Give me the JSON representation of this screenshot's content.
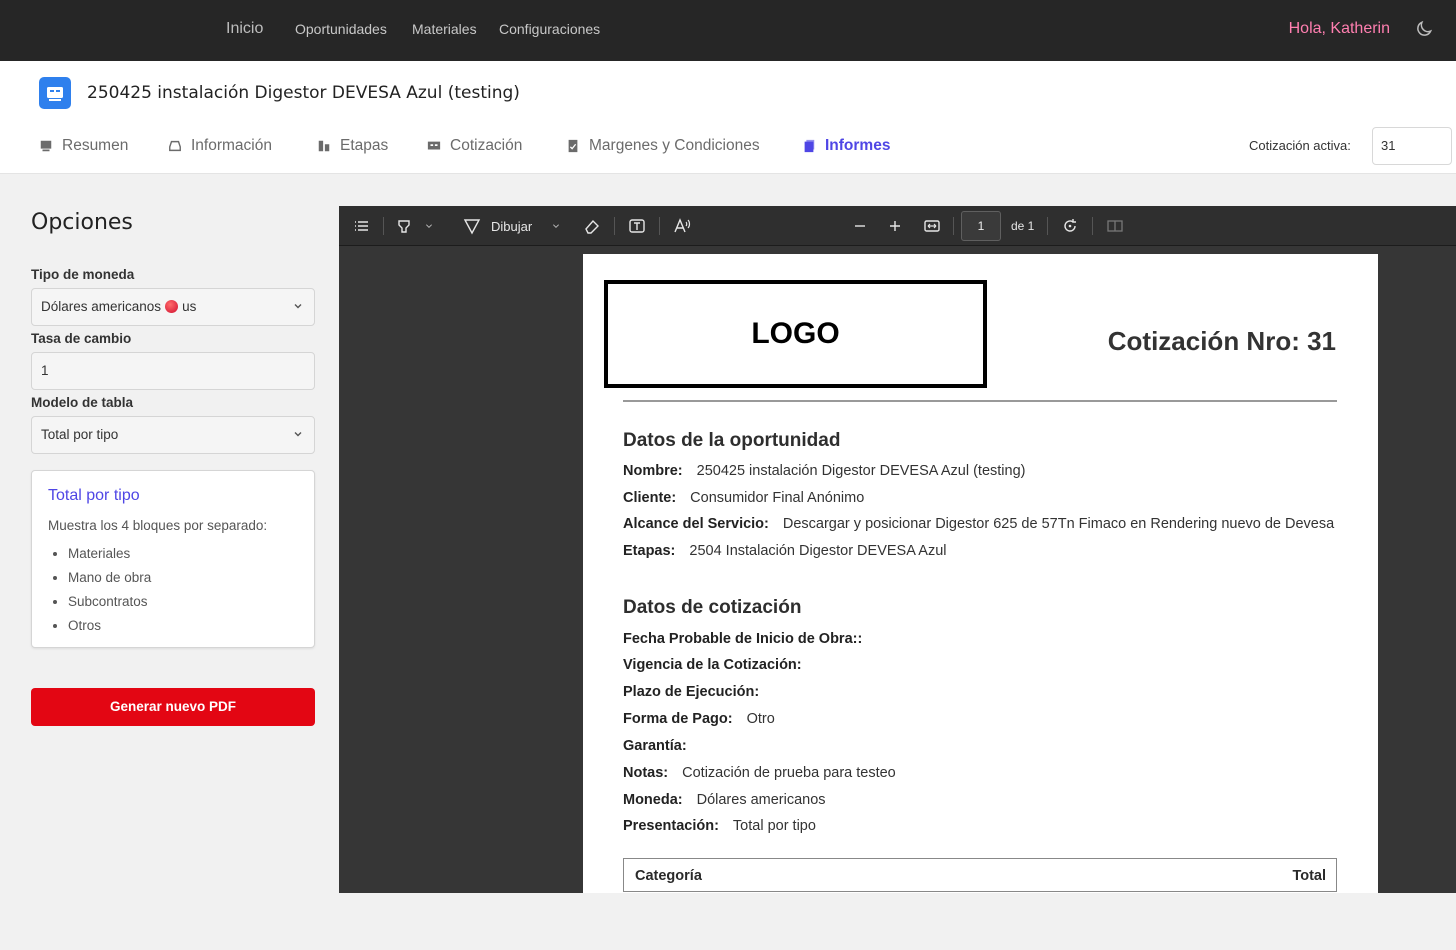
{
  "nav": {
    "home": "Inicio",
    "items": [
      "Oportunidades",
      "Materiales",
      "Configuraciones"
    ],
    "greeting": "Hola, Katherin"
  },
  "header": {
    "title": "250425 instalación Digestor DEVESA Azul (testing)",
    "tabs": [
      "Resumen",
      "Información",
      "Etapas",
      "Cotización",
      "Margenes y Condiciones",
      "Informes"
    ],
    "active_tab": "Informes",
    "active_quote_label": "Cotización activa:",
    "active_quote_value": "31"
  },
  "options": {
    "title": "Opciones",
    "currency_label": "Tipo de moneda",
    "currency_value": "Dólares americanos",
    "currency_code": "us",
    "rate_label": "Tasa de cambio",
    "rate_value": "1",
    "model_label": "Modelo de tabla",
    "model_value": "Total por tipo",
    "card": {
      "title": "Total por tipo",
      "desc": "Muestra los 4 bloques por separado:",
      "items": [
        "Materiales",
        "Mano de obra",
        "Subcontratos",
        "Otros"
      ]
    },
    "generate_button": "Generar nuevo PDF"
  },
  "viewer": {
    "draw_label": "Dibujar",
    "page_current": "1",
    "page_of": "de 1"
  },
  "pdf": {
    "logo": "LOGO",
    "quote_title": "Cotización Nro: 31",
    "section1": "Datos de la oportunidad",
    "opp": [
      {
        "label": "Nombre:",
        "value": "250425 instalación Digestor DEVESA Azul (testing)"
      },
      {
        "label": "Cliente:",
        "value": "Consumidor Final Anónimo"
      },
      {
        "label": "Alcance del Servicio:",
        "value": "Descargar y posicionar Digestor 625 de 57Tn Fimaco en Rendering nuevo de Devesa"
      },
      {
        "label": "Etapas:",
        "value": "2504 Instalación Digestor DEVESA Azul"
      }
    ],
    "section2": "Datos de cotización",
    "quote": [
      {
        "label": "Fecha Probable de Inicio de Obra::",
        "value": ""
      },
      {
        "label": "Vigencia de la Cotización:",
        "value": ""
      },
      {
        "label": "Plazo de Ejecución:",
        "value": ""
      },
      {
        "label": "Forma de Pago:",
        "value": "Otro"
      },
      {
        "label": "Garantía:",
        "value": ""
      },
      {
        "label": "Notas:",
        "value": "Cotización de prueba para testeo"
      },
      {
        "label": "Moneda:",
        "value": "Dólares americanos"
      },
      {
        "label": "Presentación:",
        "value": "Total por tipo"
      }
    ],
    "table_headers": [
      "Categoría",
      "Total"
    ]
  },
  "colors": {
    "accent": "#4f46e5",
    "greeting": "#ff7fb0",
    "button": "#e30613",
    "topbar": "#262626"
  }
}
